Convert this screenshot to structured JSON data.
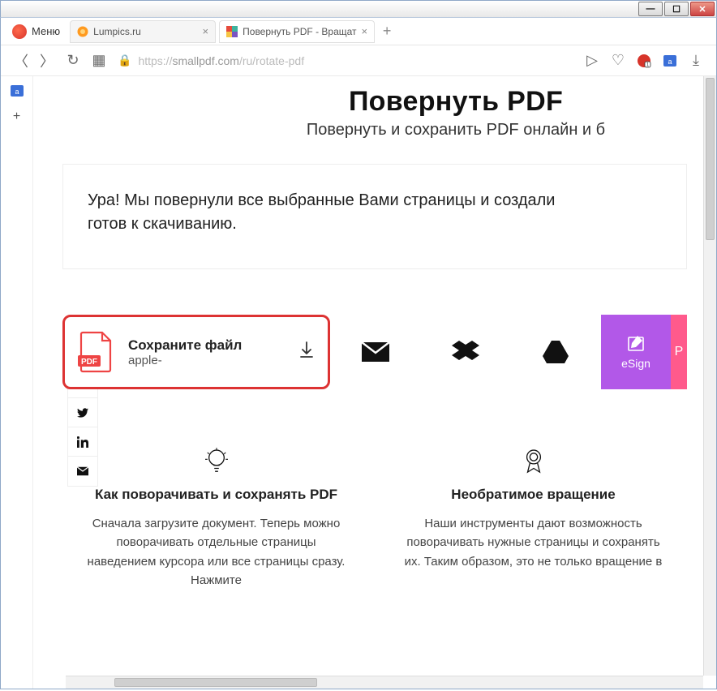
{
  "window": {
    "title": ""
  },
  "menu": {
    "label": "Меню"
  },
  "tabs": [
    {
      "label": "Lumpics.ru"
    },
    {
      "label": "Повернуть PDF - Вращат"
    }
  ],
  "url": {
    "proto": "https://",
    "host": "smallpdf.com",
    "path": "/ru/rotate-pdf"
  },
  "page": {
    "title": "Повернуть PDF",
    "subtitle": "Повернуть и сохранить PDF онлайн и б"
  },
  "success": {
    "line1": "Ура! Мы повернули все выбранные Вами страницы и создали",
    "line2": "готов к скачиванию."
  },
  "download": {
    "title": "Сохраните файл",
    "filename": "apple-"
  },
  "esign": {
    "label": "eSign"
  },
  "stub": {
    "label": "P"
  },
  "columns": {
    "left": {
      "title": "Как поворачивать и сохранять PDF",
      "body": "Сначала загрузите документ. Теперь можно поворачивать отдельные страницы наведением курсора или все страницы сразу. Нажмите"
    },
    "right": {
      "title": "Необратимое вращение",
      "body": "Наши инструменты дают возможность поворачивать нужные страницы и сохранять их. Таким образом, это не только вращение в"
    }
  }
}
